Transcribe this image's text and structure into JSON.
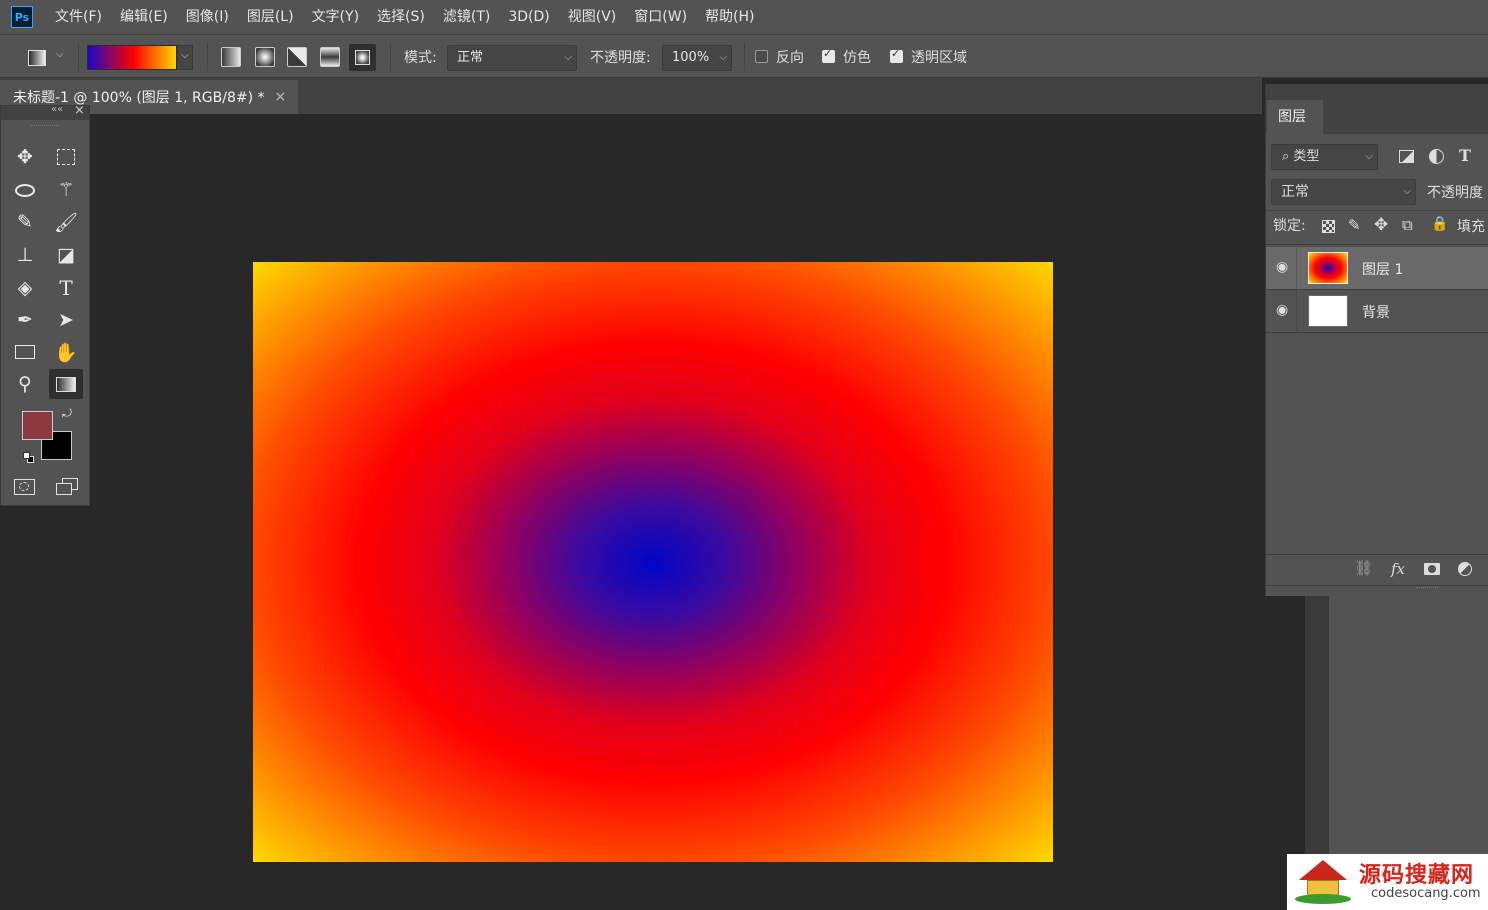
{
  "app": {
    "logo": "Ps"
  },
  "menu": [
    "文件(F)",
    "编辑(E)",
    "图像(I)",
    "图层(L)",
    "文字(Y)",
    "选择(S)",
    "滤镜(T)",
    "3D(D)",
    "视图(V)",
    "窗口(W)",
    "帮助(H)"
  ],
  "options": {
    "mode_label": "模式:",
    "mode_value": "正常",
    "opacity_label": "不透明度:",
    "opacity_value": "100%",
    "reverse_label": "反向",
    "reverse_checked": false,
    "dither_label": "仿色",
    "dither_checked": true,
    "transparency_label": "透明区域",
    "transparency_checked": true,
    "gradient_colors": [
      "#1b08c8",
      "#ff0000",
      "#ffd800"
    ]
  },
  "document": {
    "tab_title": "未标题-1 @ 100% (图层 1, RGB/8#) *",
    "close": "×"
  },
  "tools_panel": {
    "collapse": "««",
    "close": "×",
    "foreground_color": "#8c3a3f",
    "background_color": "#000000",
    "tools": [
      "move-icon",
      "marquee-icon",
      "lasso-icon",
      "magic-wand-icon",
      "eyedropper-icon",
      "brush-icon",
      "stamp-icon",
      "eraser-icon",
      "paint-bucket-icon",
      "type-icon",
      "pen-icon",
      "path-select-icon",
      "rectangle-icon",
      "hand-icon",
      "zoom-icon",
      "gradient-icon"
    ],
    "type_tool_glyph": "T"
  },
  "layers_panel": {
    "tab": "图层",
    "filter_label": "类型",
    "blend_mode": "正常",
    "opacity_label": "不透明度",
    "lock_label": "锁定:",
    "fill_label": "填充",
    "text_filter_glyph": "T",
    "fx_label": "fx",
    "layers": [
      {
        "name": "图层 1",
        "visible": true,
        "selected": true
      },
      {
        "name": "背景",
        "visible": true,
        "selected": false
      }
    ]
  },
  "canvas": {
    "gradient": "radial",
    "colors": [
      "#0006c8",
      "#ff0000",
      "#ffff00"
    ]
  },
  "watermark": {
    "title": "源码搜藏网",
    "url": "codesocang.com"
  }
}
